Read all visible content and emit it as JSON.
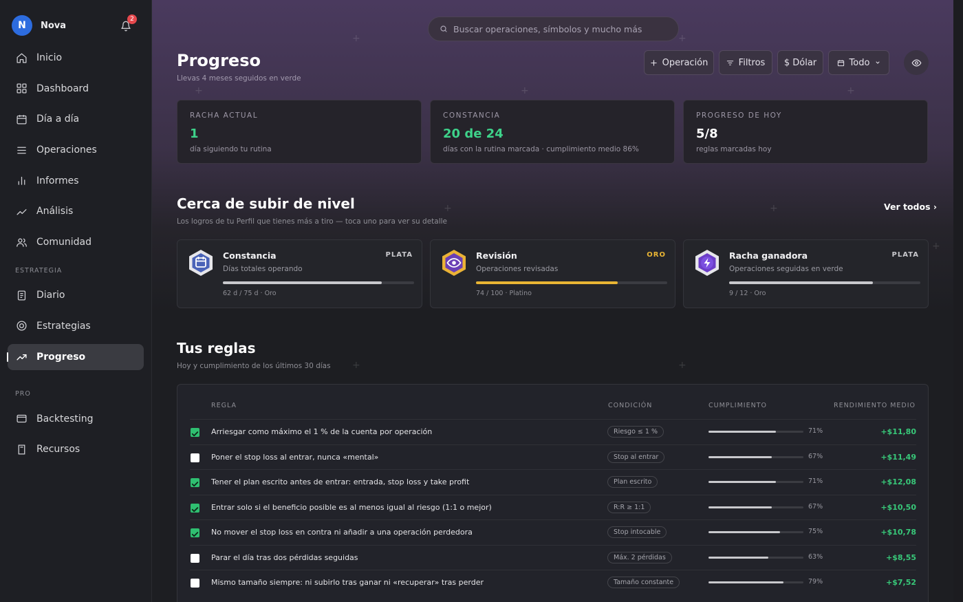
{
  "user": {
    "initial": "N",
    "name": "Nova",
    "notifications": "2"
  },
  "nav": [
    {
      "label": "Inicio",
      "icon": "home-icon"
    },
    {
      "label": "Dashboard",
      "icon": "grid-icon"
    },
    {
      "label": "Día a día",
      "icon": "calendar-icon"
    },
    {
      "label": "Operaciones",
      "icon": "list-icon"
    },
    {
      "label": "Informes",
      "icon": "bar-chart-icon"
    },
    {
      "label": "Análisis",
      "icon": "trend-icon"
    },
    {
      "label": "Comunidad",
      "icon": "users-icon"
    }
  ],
  "sections": {
    "strategy": "ESTRATEGIA",
    "pro": "PRO"
  },
  "strategy_nav": [
    {
      "label": "Diario",
      "icon": "journal-icon"
    },
    {
      "label": "Estrategias",
      "icon": "target-icon"
    },
    {
      "label": "Progreso",
      "icon": "progress-icon",
      "active": true
    }
  ],
  "pro_nav": [
    {
      "label": "Backtesting",
      "icon": "window-icon"
    },
    {
      "label": "Recursos",
      "icon": "book-icon"
    }
  ],
  "search": {
    "placeholder": "Buscar operaciones, símbolos y mucho más"
  },
  "header": {
    "title": "Progreso",
    "subtitle": "Llevas 4 meses seguidos en verde"
  },
  "toolbar": {
    "operation": "Operación",
    "filters": "Filtros",
    "currency": "$ Dólar",
    "period": "Todo"
  },
  "stats": [
    {
      "label": "RACHA ACTUAL",
      "value": "1",
      "desc": "día siguiendo tu rutina",
      "color": "#3ed28a"
    },
    {
      "label": "CONSTANCIA",
      "value": "20 de 24",
      "desc": "días con la rutina marcada · cumplimiento medio 86%",
      "color": "#3ed28a"
    },
    {
      "label": "PROGRESO DE HOY",
      "value": "5/8",
      "desc": "reglas marcadas hoy",
      "color": "#ffffff"
    }
  ],
  "level": {
    "title": "Cerca de subir de nivel",
    "subtitle": "Los logros de tu Perfil que tienes más a tiro — toca uno para ver su detalle",
    "see_all": "Ver todos ›"
  },
  "achievements": [
    {
      "name": "Constancia",
      "tier": "PLATA",
      "desc": "Días totales operando",
      "progress": 0.83,
      "foot": "62 d / 75 d · Oro",
      "tier_color": "#c8c8cc",
      "bar_color": "#c8c8cc",
      "icon": "calendar-badge-icon"
    },
    {
      "name": "Revisión",
      "tier": "ORO",
      "desc": "Operaciones revisadas",
      "progress": 0.74,
      "foot": "74 / 100 · Platino",
      "tier_color": "#e9b534",
      "bar_color": "#e9b534",
      "icon": "eye-badge-icon"
    },
    {
      "name": "Racha ganadora",
      "tier": "PLATA",
      "desc": "Operaciones seguidas en verde",
      "progress": 0.75,
      "foot": "9 / 12 · Oro",
      "tier_color": "#c8c8cc",
      "bar_color": "#c8c8cc",
      "icon": "bolt-badge-icon"
    }
  ],
  "rules_section": {
    "title": "Tus reglas",
    "subtitle": "Hoy y cumplimiento de los últimos 30 días"
  },
  "rules_headers": {
    "rule": "REGLA",
    "condition": "CONDICIÓN",
    "compliance": "CUMPLIMIENTO",
    "performance": "RENDIMIENTO MEDIO"
  },
  "rules": [
    {
      "checked": true,
      "text": "Arriesgar como máximo el 1 % de la cuenta por operación",
      "condition": "Riesgo ≤ 1 %",
      "compliance": 71,
      "compliance_label": "71%",
      "performance": "+$11,80"
    },
    {
      "checked": false,
      "text": "Poner el stop loss al entrar, nunca «mental»",
      "condition": "Stop al entrar",
      "compliance": 67,
      "compliance_label": "67%",
      "performance": "+$11,49"
    },
    {
      "checked": true,
      "text": "Tener el plan escrito antes de entrar: entrada, stop loss y take profit",
      "condition": "Plan escrito",
      "compliance": 71,
      "compliance_label": "71%",
      "performance": "+$12,08"
    },
    {
      "checked": true,
      "text": "Entrar solo si el beneficio posible es al menos igual al riesgo (1:1 o mejor)",
      "condition": "R:R ≥ 1:1",
      "compliance": 67,
      "compliance_label": "67%",
      "performance": "+$10,50"
    },
    {
      "checked": true,
      "text": "No mover el stop loss en contra ni añadir a una operación perdedora",
      "condition": "Stop intocable",
      "compliance": 75,
      "compliance_label": "75%",
      "performance": "+$10,78"
    },
    {
      "checked": false,
      "text": "Parar el día tras dos pérdidas seguidas",
      "condition": "Máx. 2 pérdidas",
      "compliance": 63,
      "compliance_label": "63%",
      "performance": "+$8,55"
    },
    {
      "checked": false,
      "text": "Mismo tamaño siempre: ni subirlo tras ganar ni «recuperar» tras perder",
      "condition": "Tamaño constante",
      "compliance": 79,
      "compliance_label": "79%",
      "performance": "+$7,52"
    }
  ]
}
